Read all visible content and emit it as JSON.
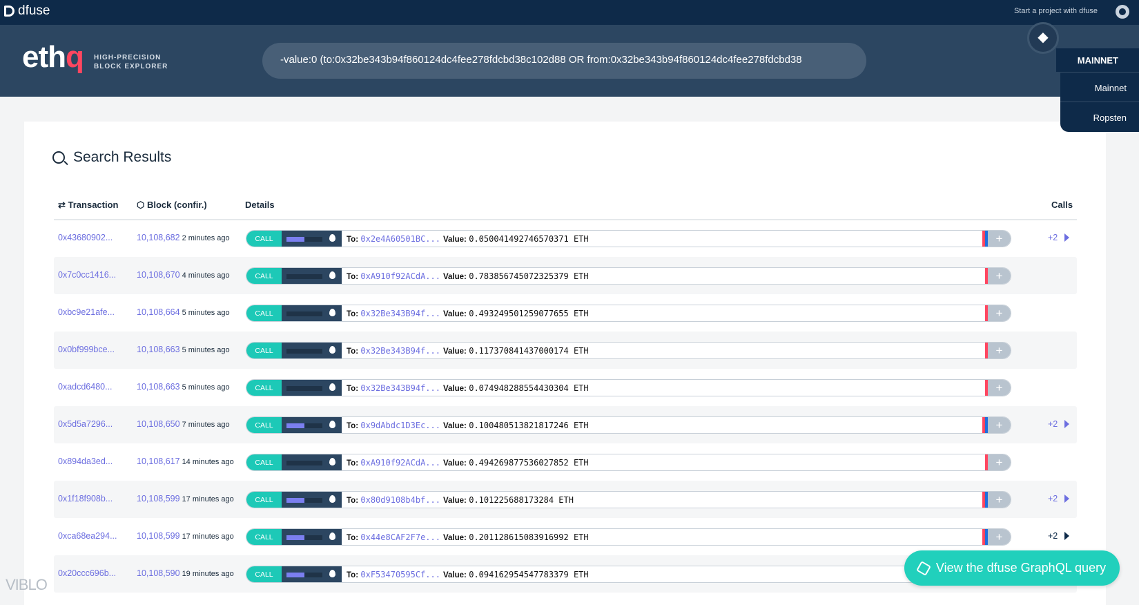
{
  "topbar": {
    "brand": "dfuse",
    "start_link": "Start a project with dfuse"
  },
  "header": {
    "logo_main": "eth",
    "logo_accent": "q",
    "tagline1": "HIGH-PRECISION",
    "tagline2": "BLOCK EXPLORER",
    "search_query": "-value:0 (to:0x32be343b94f860124dc4fee278fdcbd38c102d88 OR from:0x32be343b94f860124dc4fee278fdcbd38",
    "network": "MAINNET",
    "network_options": [
      "Mainnet",
      "Ropsten"
    ]
  },
  "results": {
    "title": "Search Results",
    "columns": {
      "transaction": "Transaction",
      "block": "Block (confir.)",
      "details": "Details",
      "calls": "Calls"
    },
    "rows": [
      {
        "tx": "0x43680902...",
        "block": "10,108,682",
        "ago": "2 minutes ago",
        "type": "CALL",
        "gas": 0.5,
        "to_label": "To:",
        "to": "0x2e4A60501BC...",
        "value_label": "Value:",
        "value": "0.050041492746570371 ETH",
        "calls": "+2"
      },
      {
        "tx": "0x7c0cc1416...",
        "block": "10,108,670",
        "ago": "4 minutes ago",
        "type": "CALL",
        "gas": 0,
        "to_label": "To:",
        "to": "0xA910f92ACdA...",
        "value_label": "Value:",
        "value": "0.783856745072325379 ETH",
        "calls": ""
      },
      {
        "tx": "0xbc9e21afe...",
        "block": "10,108,664",
        "ago": "5 minutes ago",
        "type": "CALL",
        "gas": 0,
        "to_label": "To:",
        "to": "0x32Be343B94f...",
        "value_label": "Value:",
        "value": "0.493249501259077655 ETH",
        "calls": ""
      },
      {
        "tx": "0x0bf999bce...",
        "block": "10,108,663",
        "ago": "5 minutes ago",
        "type": "CALL",
        "gas": 0,
        "to_label": "To:",
        "to": "0x32Be343B94f...",
        "value_label": "Value:",
        "value": "0.117370841437000174 ETH",
        "calls": ""
      },
      {
        "tx": "0xadcd6480...",
        "block": "10,108,663",
        "ago": "5 minutes ago",
        "type": "CALL",
        "gas": 0,
        "to_label": "To:",
        "to": "0x32Be343B94f...",
        "value_label": "Value:",
        "value": "0.074948288554430304 ETH",
        "calls": ""
      },
      {
        "tx": "0x5d5a7296...",
        "block": "10,108,650",
        "ago": "7 minutes ago",
        "type": "CALL",
        "gas": 0.5,
        "to_label": "To:",
        "to": "0x9dAbdc1D3Ec...",
        "value_label": "Value:",
        "value": "0.100480513821817246 ETH",
        "calls": "+2"
      },
      {
        "tx": "0x894da3ed...",
        "block": "10,108,617",
        "ago": "14 minutes ago",
        "type": "CALL",
        "gas": 0,
        "to_label": "To:",
        "to": "0xA910f92ACdA...",
        "value_label": "Value:",
        "value": "0.494269877536027852 ETH",
        "calls": ""
      },
      {
        "tx": "0x1f18f908b...",
        "block": "10,108,599",
        "ago": "17 minutes ago",
        "type": "CALL",
        "gas": 0.5,
        "to_label": "To:",
        "to": "0x80d9108b4bf...",
        "value_label": "Value:",
        "value": "0.101225688173284 ETH",
        "calls": "+2"
      },
      {
        "tx": "0xca68ea294...",
        "block": "10,108,599",
        "ago": "17 minutes ago",
        "type": "CALL",
        "gas": 0.5,
        "to_label": "To:",
        "to": "0x44e8CAF2F7e...",
        "value_label": "Value:",
        "value": "0.201128615083916992 ETH",
        "calls": "+2"
      },
      {
        "tx": "0x20ccc696b...",
        "block": "10,108,590",
        "ago": "19 minutes ago",
        "type": "CALL",
        "gas": 0.5,
        "to_label": "To:",
        "to": "0xF53470595Cf...",
        "value_label": "Value:",
        "value": "0.094162954547783379 ETH",
        "calls": ""
      }
    ]
  },
  "graphql_button": "View the dfuse GraphQL query",
  "watermark": "VIBLO",
  "colors": {
    "accent": "#1dc9b7",
    "link": "#6c6ee0",
    "brand_red": "#ff4660",
    "navy": "#0e2a49"
  }
}
